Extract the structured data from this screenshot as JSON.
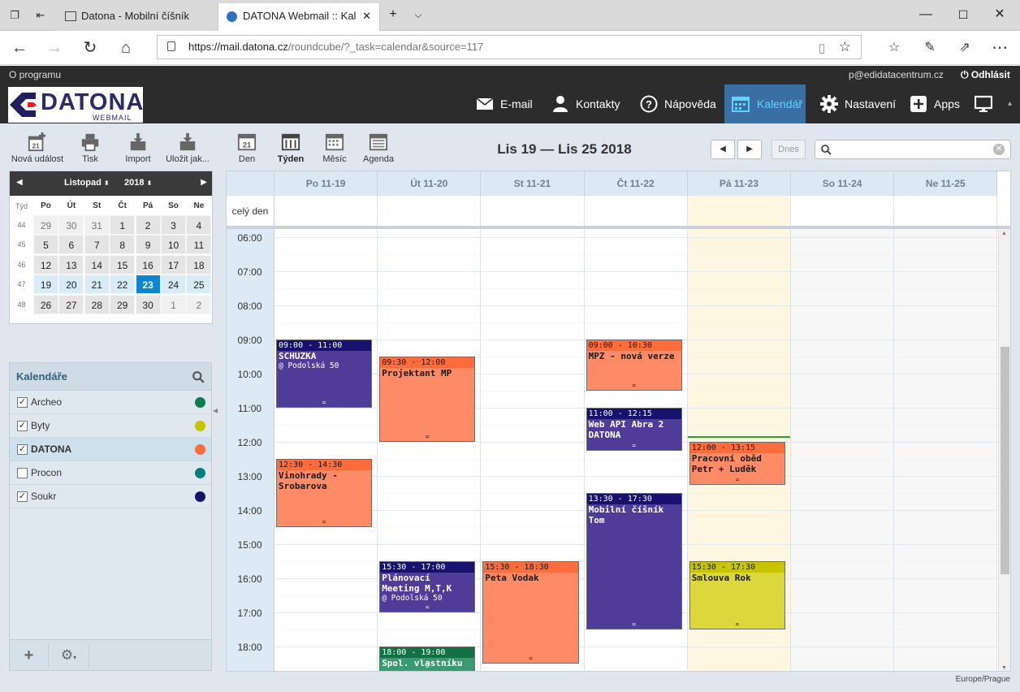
{
  "browser": {
    "tabs": [
      {
        "title": "Datona - Mobilní číšník"
      },
      {
        "title": "DATONA Webmail :: Kal"
      }
    ],
    "url_host": "https://mail.datona.cz",
    "url_path": "/roundcube/?_task=calendar&source=117"
  },
  "topline": {
    "about": "O programu",
    "user": "p@edidatacentrum.cz",
    "logout": "Odhlásit"
  },
  "logo": {
    "brand": "DATONA",
    "sub": "WEBMAIL"
  },
  "nav": [
    {
      "label": "E-mail",
      "icon": "envelope-icon"
    },
    {
      "label": "Kontakty",
      "icon": "person-icon"
    },
    {
      "label": "Nápověda",
      "icon": "help-icon"
    },
    {
      "label": "Kalendář",
      "icon": "calendar-icon",
      "selected": true
    },
    {
      "label": "Nastavení",
      "icon": "gear-icon"
    },
    {
      "label": "Apps",
      "icon": "plus-box-icon"
    }
  ],
  "toolbar": {
    "new_event": "Nová událost",
    "print": "Tisk",
    "import": "Import",
    "save": "Uložit jak...",
    "views": [
      "Den",
      "Týden",
      "Měsíc",
      "Agenda"
    ],
    "view_day_num": "21",
    "active_view": "Týden",
    "today": "Dnes"
  },
  "title": "Lis 19 — Lis 25 2018",
  "minical": {
    "month": "Listopad",
    "year": "2018",
    "week_label": "Týd",
    "daynames": [
      "Po",
      "Út",
      "St",
      "Čt",
      "Pá",
      "So",
      "Ne"
    ],
    "weeks": [
      {
        "wk": "44",
        "days": [
          "29",
          "30",
          "31",
          "1",
          "2",
          "3",
          "4"
        ]
      },
      {
        "wk": "45",
        "days": [
          "5",
          "6",
          "7",
          "8",
          "9",
          "10",
          "11"
        ]
      },
      {
        "wk": "46",
        "days": [
          "12",
          "13",
          "14",
          "15",
          "16",
          "17",
          "18"
        ]
      },
      {
        "wk": "47",
        "days": [
          "19",
          "20",
          "21",
          "22",
          "23",
          "24",
          "25"
        ]
      },
      {
        "wk": "48",
        "days": [
          "26",
          "27",
          "28",
          "29",
          "30",
          "1",
          "2"
        ]
      }
    ],
    "today": "23"
  },
  "calendars": {
    "title": "Kalendáře",
    "items": [
      {
        "name": "Archeo",
        "checked": true,
        "color": "#0d7c52"
      },
      {
        "name": "Byty",
        "checked": true,
        "color": "#c9c400"
      },
      {
        "name": "DATONA",
        "checked": true,
        "color": "#fe6c3c",
        "selected": true
      },
      {
        "name": "Procon",
        "checked": false,
        "color": "#007f7f"
      },
      {
        "name": "Soukr",
        "checked": true,
        "color": "#16126d"
      }
    ]
  },
  "week": {
    "allday_label": "celý den",
    "days": [
      "Po 11-19",
      "Út 11-20",
      "St 11-21",
      "Čt 11-22",
      "Pá 11-23",
      "So 11-24",
      "Ne 11-25"
    ],
    "hours": [
      "06:00",
      "07:00",
      "08:00",
      "09:00",
      "10:00",
      "11:00",
      "12:00",
      "13:00",
      "14:00",
      "15:00",
      "16:00",
      "17:00",
      "18:00"
    ]
  },
  "events": [
    {
      "time": "09:00 - 11:00",
      "title": "SCHUZKA",
      "location": "@ Podolská 50",
      "day": "Po 11-19",
      "color": "blue"
    },
    {
      "time": "12:30 - 14:30",
      "title": "Vinohrady - Srobarova",
      "day": "Po 11-19",
      "color": "orange"
    },
    {
      "time": "09:30 - 12:00",
      "title": "Projektant MP",
      "day": "Út 11-20",
      "color": "orange"
    },
    {
      "time": "15:30 - 17:00",
      "title": "Plánovací Meeting M,T,K",
      "location": "@ Podolská 50",
      "day": "Út 11-20",
      "color": "blue"
    },
    {
      "time": "18:00 - 19:00",
      "title": "Spol. vlastníku",
      "day": "Út 11-20",
      "color": "green"
    },
    {
      "time": "15:30 - 18:30",
      "title": "Peta Vodak",
      "day": "St 11-21",
      "color": "orange"
    },
    {
      "time": "09:00 - 10:30",
      "title": "MPZ - nová verze",
      "day": "Čt 11-22",
      "color": "orange"
    },
    {
      "time": "11:00 - 12:15",
      "title": "Web API Abra 2 DATONA",
      "day": "Čt 11-22",
      "color": "blue"
    },
    {
      "time": "13:30 - 17:30",
      "title": "Mobilní číšník Tom",
      "day": "Čt 11-22",
      "color": "blue"
    },
    {
      "time": "12:00 - 13:15",
      "title": "Pracovní oběd Petr + Luděk",
      "day": "Pá 11-23",
      "color": "orange"
    },
    {
      "time": "15:30 - 17:30",
      "title": "Smlouva Rok",
      "day": "Pá 11-23",
      "color": "yellow"
    }
  ],
  "timezone": "Europe/Prague",
  "colors": {
    "accent": "#3a6fa3",
    "today": "#0c86d4",
    "header": "#2c2c2c"
  }
}
